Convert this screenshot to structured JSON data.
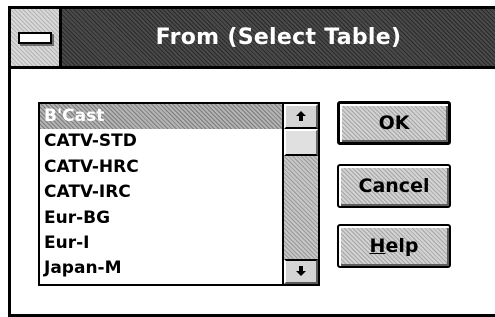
{
  "dialog": {
    "title": "From (Select Table)",
    "list": {
      "items": [
        "B'Cast",
        "CATV-STD",
        "CATV-HRC",
        "CATV-IRC",
        "Eur-BG",
        "Eur-I",
        "Japan-M"
      ],
      "selected_index": 0
    },
    "scrollbar": {
      "up_icon": "up-arrow-icon",
      "down_icon": "down-arrow-icon",
      "position": 0
    },
    "buttons": {
      "ok_label": "OK",
      "cancel_label": "Cancel",
      "help_mnemonic": "H",
      "help_rest": "elp"
    },
    "icons": {
      "system_menu": "system-menu-icon"
    }
  }
}
